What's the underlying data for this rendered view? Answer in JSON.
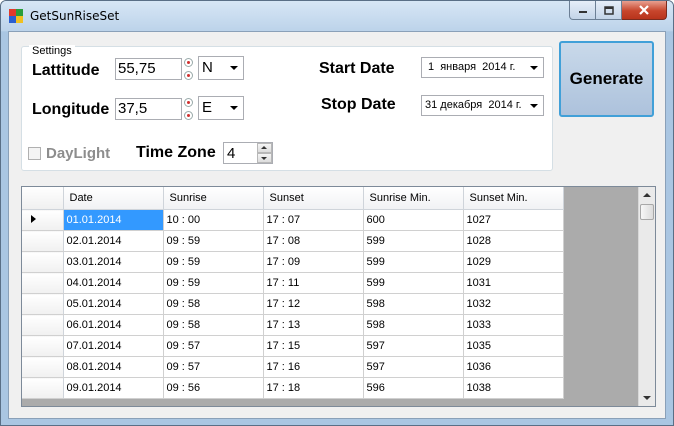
{
  "window": {
    "title": "GetSunRiseSet"
  },
  "settings": {
    "group_title": "Settings",
    "latitude_label": "Lattitude",
    "latitude_value": "55,75",
    "latitude_hemisphere": "N",
    "longitude_label": "Longitude",
    "longitude_value": "37,5",
    "longitude_hemisphere": "E",
    "start_date_label": "Start Date",
    "start_date_value": "1  января  2014 г.",
    "stop_date_label": "Stop Date",
    "stop_date_value": "31 декабря  2014 г.",
    "daylight_label": "DayLight",
    "timezone_label": "Time Zone",
    "timezone_value": "4"
  },
  "generate_label": "Generate",
  "grid": {
    "columns": [
      "Date",
      "Sunrise",
      "Sunset",
      "Sunrise Min.",
      "Sunset Min."
    ],
    "rows": [
      [
        "01.01.2014",
        "10 : 00",
        "17 : 07",
        "600",
        "1027"
      ],
      [
        "02.01.2014",
        "09 : 59",
        "17 : 08",
        "599",
        "1028"
      ],
      [
        "03.01.2014",
        "09 : 59",
        "17 : 09",
        "599",
        "1029"
      ],
      [
        "04.01.2014",
        "09 : 59",
        "17 : 11",
        "599",
        "1031"
      ],
      [
        "05.01.2014",
        "09 : 58",
        "17 : 12",
        "598",
        "1032"
      ],
      [
        "06.01.2014",
        "09 : 58",
        "17 : 13",
        "598",
        "1033"
      ],
      [
        "07.01.2014",
        "09 : 57",
        "17 : 15",
        "597",
        "1035"
      ],
      [
        "08.01.2014",
        "09 : 57",
        "17 : 16",
        "597",
        "1036"
      ],
      [
        "09.01.2014",
        "09 : 56",
        "17 : 18",
        "596",
        "1038"
      ]
    ]
  }
}
